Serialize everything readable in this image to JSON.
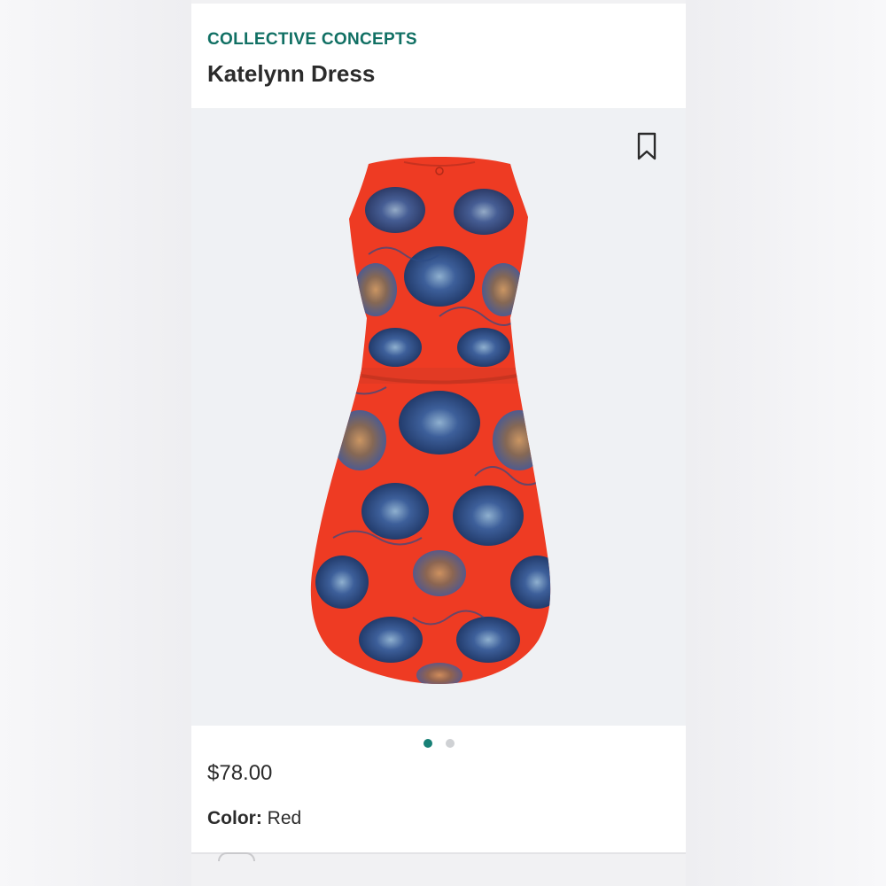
{
  "product": {
    "brand": "COLLECTIVE CONCEPTS",
    "name": "Katelynn Dress",
    "price": "$78.00",
    "color_label": "Color:",
    "color_value": "Red"
  },
  "gallery": {
    "image_count": 2,
    "active_index": 0,
    "image_subject": "dress-product-image"
  },
  "icons": {
    "bookmark": "bookmark-icon"
  },
  "colors": {
    "brand_accent": "#117064",
    "dot_active": "#178076",
    "dot_inactive": "#cfd1d4",
    "dress_base": "#ee3b23",
    "pattern_blue": "#3d5f9a"
  }
}
